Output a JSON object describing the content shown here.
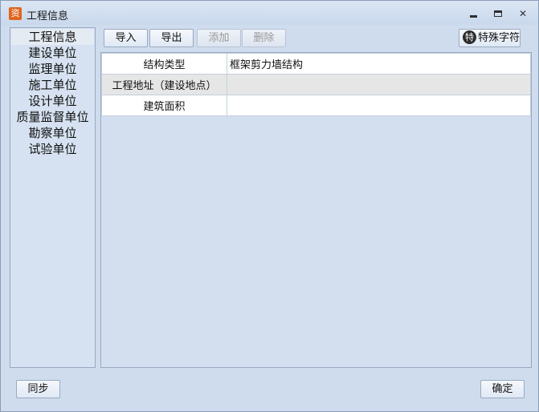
{
  "window": {
    "title": "工程信息",
    "icon_glyph": "资",
    "icon_color": "#e0651f"
  },
  "titlebar_controls": {
    "close_glyph": "✕"
  },
  "sidebar": {
    "items": [
      {
        "label": "工程信息",
        "active": true
      },
      {
        "label": "建设单位"
      },
      {
        "label": "监理单位"
      },
      {
        "label": "施工单位"
      },
      {
        "label": "设计单位"
      },
      {
        "label": "质量监督单位"
      },
      {
        "label": "勘察单位"
      },
      {
        "label": "试验单位"
      }
    ]
  },
  "toolbar": {
    "import_label": "导入",
    "export_label": "导出",
    "add_label": "添加",
    "delete_label": "删除",
    "special_label": "特殊字符",
    "special_icon_glyph": "特"
  },
  "table": {
    "rows": [
      {
        "key": "结构类型",
        "value": "框架剪力墙结构"
      },
      {
        "key": "工程地址（建设地点）",
        "value": ""
      },
      {
        "key": "建筑面积",
        "value": ""
      }
    ]
  },
  "footer": {
    "sync_label": "同步",
    "ok_label": "确定"
  }
}
